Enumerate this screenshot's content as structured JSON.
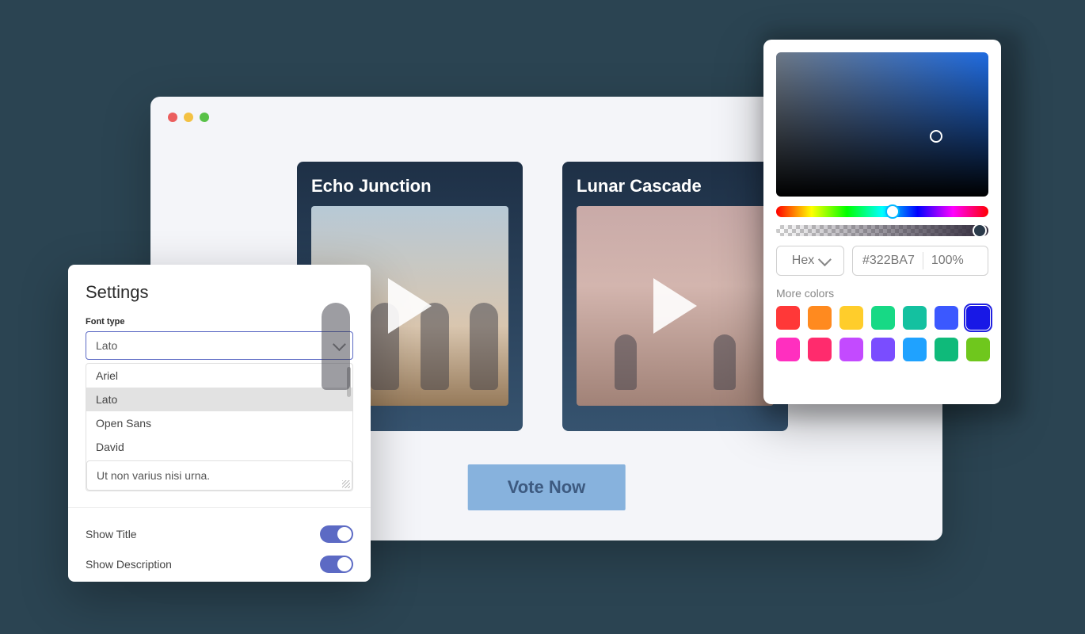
{
  "browser": {
    "cards": [
      {
        "title": "Echo Junction"
      },
      {
        "title": "Lunar Cascade"
      }
    ],
    "vote_label": "Vote Now"
  },
  "settings": {
    "title": "Settings",
    "font_type_label": "Font type",
    "selected_font": "Lato",
    "font_options": [
      "Ariel",
      "Lato",
      "Open Sans",
      "David"
    ],
    "textarea_value": "Ut non varius nisi urna.",
    "show_title_label": "Show Title",
    "show_title_on": true,
    "show_description_label": "Show Description",
    "show_description_on": true
  },
  "picker": {
    "format": "Hex",
    "hex": "#322BA7",
    "opacity": "100%",
    "more_label": "More colors",
    "swatches": [
      "#ff3838",
      "#ff8a1f",
      "#ffcd2b",
      "#17d985",
      "#14c1a0",
      "#3b58ff",
      "#1818e6",
      "#ff2fbf",
      "#ff2b6d",
      "#c34aff",
      "#7a4dff",
      "#1fa2ff",
      "#0fba7a",
      "#6fc71d"
    ],
    "selected_swatch_index": 6
  }
}
